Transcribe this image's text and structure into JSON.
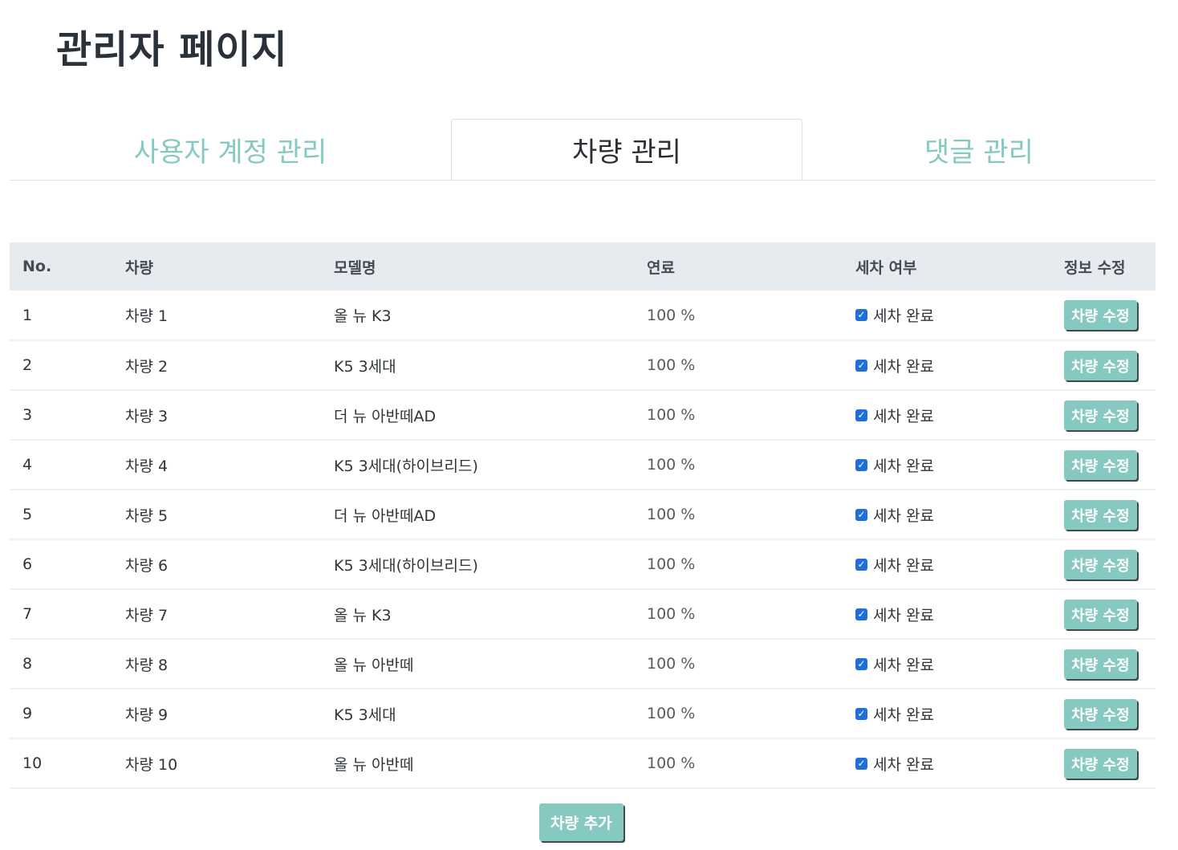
{
  "page": {
    "title": "관리자 페이지"
  },
  "tabs": [
    {
      "label": "사용자 계정 관리",
      "active": false
    },
    {
      "label": "차량 관리",
      "active": true
    },
    {
      "label": "댓글 관리",
      "active": false
    }
  ],
  "table": {
    "headers": [
      "No.",
      "차량",
      "모델명",
      "연료",
      "세차 여부",
      "정보 수정"
    ],
    "rows": [
      {
        "no": "1",
        "car": "차량 1",
        "model": "올 뉴 K3",
        "fuel": "100 %",
        "wash": "세차 완료",
        "wash_checked": true,
        "action": "차량 수정"
      },
      {
        "no": "2",
        "car": "차량 2",
        "model": "K5 3세대",
        "fuel": "100 %",
        "wash": "세차 완료",
        "wash_checked": true,
        "action": "차량 수정"
      },
      {
        "no": "3",
        "car": "차량 3",
        "model": "더 뉴 아반떼AD",
        "fuel": "100 %",
        "wash": "세차 완료",
        "wash_checked": true,
        "action": "차량 수정"
      },
      {
        "no": "4",
        "car": "차량 4",
        "model": "K5 3세대(하이브리드)",
        "fuel": "100 %",
        "wash": "세차 완료",
        "wash_checked": true,
        "action": "차량 수정"
      },
      {
        "no": "5",
        "car": "차량 5",
        "model": "더 뉴 아반떼AD",
        "fuel": "100 %",
        "wash": "세차 완료",
        "wash_checked": true,
        "action": "차량 수정"
      },
      {
        "no": "6",
        "car": "차량 6",
        "model": "K5 3세대(하이브리드)",
        "fuel": "100 %",
        "wash": "세차 완료",
        "wash_checked": true,
        "action": "차량 수정"
      },
      {
        "no": "7",
        "car": "차량 7",
        "model": "올 뉴 K3",
        "fuel": "100 %",
        "wash": "세차 완료",
        "wash_checked": true,
        "action": "차량 수정"
      },
      {
        "no": "8",
        "car": "차량 8",
        "model": "올 뉴 아반떼",
        "fuel": "100 %",
        "wash": "세차 완료",
        "wash_checked": true,
        "action": "차량 수정"
      },
      {
        "no": "9",
        "car": "차량 9",
        "model": "K5 3세대",
        "fuel": "100 %",
        "wash": "세차 완료",
        "wash_checked": true,
        "action": "차량 수정"
      },
      {
        "no": "10",
        "car": "차량 10",
        "model": "올 뉴 아반떼",
        "fuel": "100 %",
        "wash": "세차 완료",
        "wash_checked": true,
        "action": "차량 수정"
      }
    ]
  },
  "add_button": {
    "label": "차량 추가"
  },
  "colors": {
    "accent": "#86c9c0",
    "header_bg": "#e6ebef",
    "checkbox": "#1f6fd6",
    "title": "#2b3138"
  }
}
